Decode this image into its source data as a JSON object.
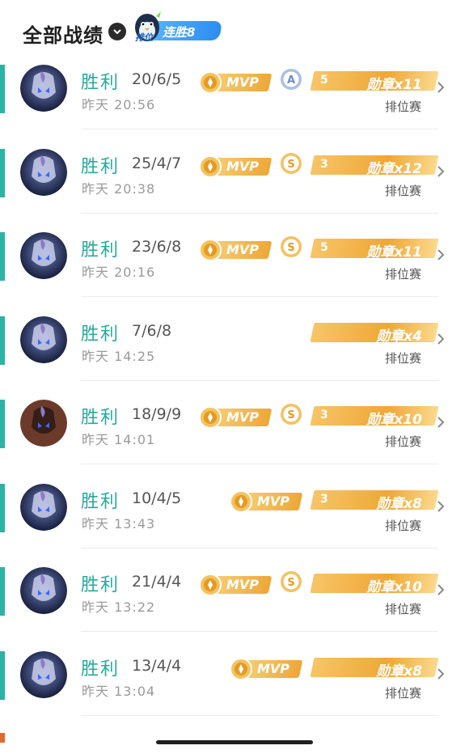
{
  "header": {
    "title": "全部战绩",
    "rank_badge": {
      "mascot_label": "排位",
      "streak_label": "连胜8"
    }
  },
  "matches": [
    {
      "result": "胜利",
      "kda": "20/6/5",
      "time": "昨天 20:56",
      "mvp": "MVP",
      "grade": "A",
      "medal_prefix": "5",
      "medal_label": "勋章x11",
      "mode": "排位赛",
      "hero": "hero-a"
    },
    {
      "result": "胜利",
      "kda": "25/4/7",
      "time": "昨天 20:38",
      "mvp": "MVP",
      "grade": "S",
      "medal_prefix": "3",
      "medal_label": "勋章x12",
      "mode": "排位赛",
      "hero": "hero-a"
    },
    {
      "result": "胜利",
      "kda": "23/6/8",
      "time": "昨天 20:16",
      "mvp": "MVP",
      "grade": "S",
      "medal_prefix": "5",
      "medal_label": "勋章x11",
      "mode": "排位赛",
      "hero": "hero-a"
    },
    {
      "result": "胜利",
      "kda": "7/6/8",
      "time": "昨天 14:25",
      "mvp": "",
      "grade": "",
      "medal_prefix": "",
      "medal_label": "勋章x4",
      "mode": "排位赛",
      "hero": "hero-a"
    },
    {
      "result": "胜利",
      "kda": "18/9/9",
      "time": "昨天 14:01",
      "mvp": "MVP",
      "grade": "S",
      "medal_prefix": "3",
      "medal_label": "勋章x10",
      "mode": "排位赛",
      "hero": "hero-b"
    },
    {
      "result": "胜利",
      "kda": "10/4/5",
      "time": "昨天 13:43",
      "mvp": "MVP",
      "grade": "",
      "medal_prefix": "3",
      "medal_label": "勋章x8",
      "mode": "排位赛",
      "hero": "hero-a"
    },
    {
      "result": "胜利",
      "kda": "21/4/4",
      "time": "昨天 13:22",
      "mvp": "MVP",
      "grade": "S",
      "medal_prefix": "",
      "medal_label": "勋章x10",
      "mode": "排位赛",
      "hero": "hero-a"
    },
    {
      "result": "胜利",
      "kda": "13/4/4",
      "time": "昨天 13:04",
      "mvp": "MVP",
      "grade": "",
      "medal_prefix": "",
      "medal_label": "勋章x8",
      "mode": "排位赛",
      "hero": "hero-a"
    }
  ],
  "colors": {
    "win": "#27a99c",
    "accent": "#2bb3a6",
    "gold": "#f0a736",
    "streak": "#2d8cf0"
  },
  "icons": {
    "chevron": "chevron-down-icon",
    "arrow": "chevron-right-icon"
  }
}
